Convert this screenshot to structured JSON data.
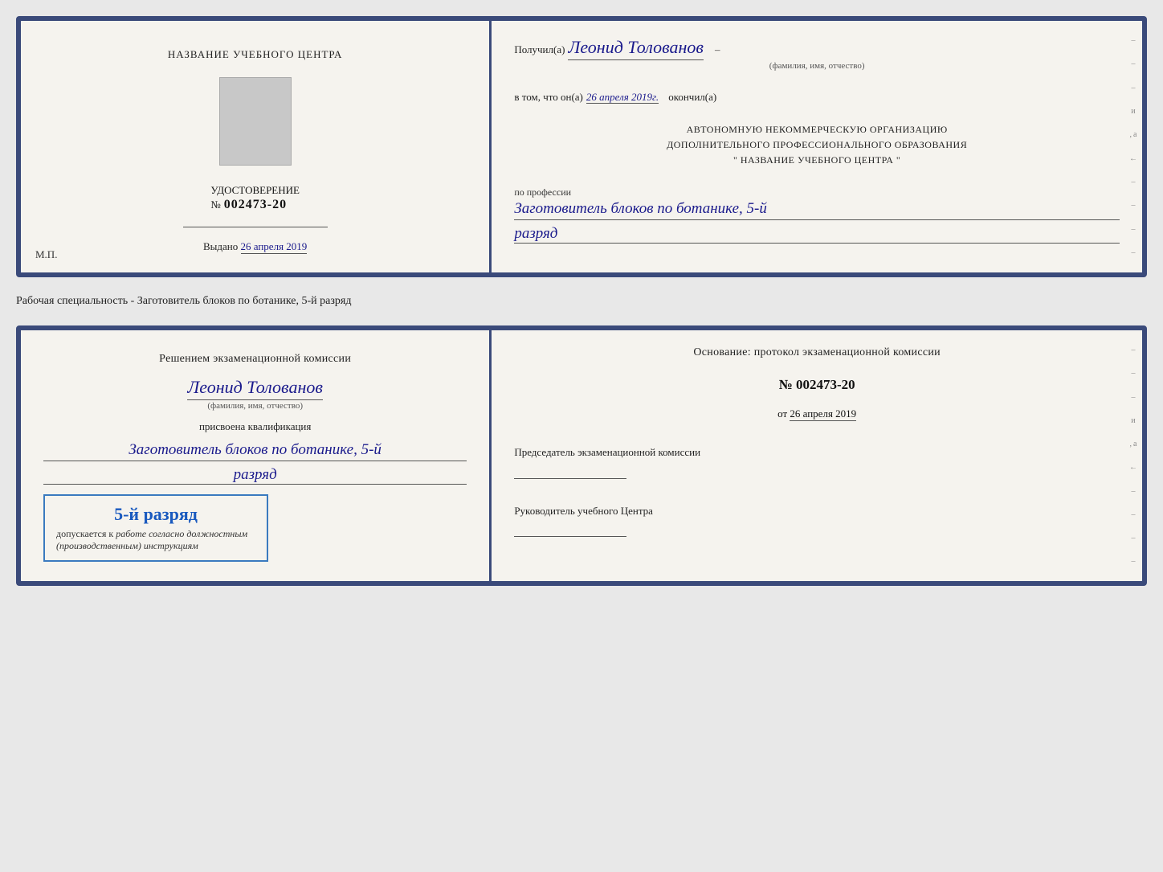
{
  "page": {
    "background": "#e8e8e8"
  },
  "specialty_label": "Рабочая специальность - Заготовитель блоков по ботанике, 5-й разряд",
  "top_doc": {
    "left": {
      "title": "НАЗВАНИЕ УЧЕБНОГО ЦЕНТРА",
      "cert_label": "УДОСТОВЕРЕНИЕ",
      "cert_number_prefix": "№",
      "cert_number": "002473-20",
      "issued_label": "Выдано",
      "issued_date": "26 апреля 2019",
      "mp_label": "М.П."
    },
    "right": {
      "received_prefix": "Получил(а)",
      "received_name": "Леонид Толованов",
      "fio_label": "(фамилия, имя, отчество)",
      "dash": "–",
      "certified_line1": "в том, что он(а)",
      "certified_date": "26 апреля 2019г.",
      "certified_suffix": "окончил(а)",
      "org_line1": "АВТОНОМНУЮ НЕКОММЕРЧЕСКУЮ ОРГАНИЗАЦИЮ",
      "org_line2": "ДОПОЛНИТЕЛЬНОГО ПРОФЕССИОНАЛЬНОГО ОБРАЗОВАНИЯ",
      "org_line3": "\"   НАЗВАНИЕ УЧЕБНОГО ЦЕНТРА   \"",
      "profession_label": "по профессии",
      "profession_value": "Заготовитель блоков по ботанике, 5-й",
      "razryad_value": "разряд"
    },
    "right_strip": [
      "–",
      "–",
      "–",
      "и",
      ",а",
      "←",
      "–",
      "–",
      "–",
      "–"
    ]
  },
  "bottom_doc": {
    "left": {
      "decision_text": "Решением экзаменационной комиссии",
      "person_name": "Леонид Толованов",
      "fio_label": "(фамилия, имя, отчество)",
      "assigned_label": "присвоена квалификация",
      "profession_value": "Заготовитель блоков по ботанике, 5-й",
      "razryad_value": "разряд",
      "stamp_main": "5-й разряд",
      "stamp_sub": "допускается к",
      "stamp_italic": "работе согласно должностным (производственным) инструкциям"
    },
    "right": {
      "osnov_label": "Основание: протокол экзаменационной комиссии",
      "number_prefix": "№",
      "number": "002473-20",
      "date_prefix": "от",
      "date_value": "26 апреля 2019",
      "chairman_label": "Председатель экзаменационной комиссии",
      "director_label": "Руководитель учебного Центра"
    },
    "right_strip": [
      "–",
      "–",
      "–",
      "и",
      ",а",
      "←",
      "–",
      "–",
      "–",
      "–"
    ]
  }
}
